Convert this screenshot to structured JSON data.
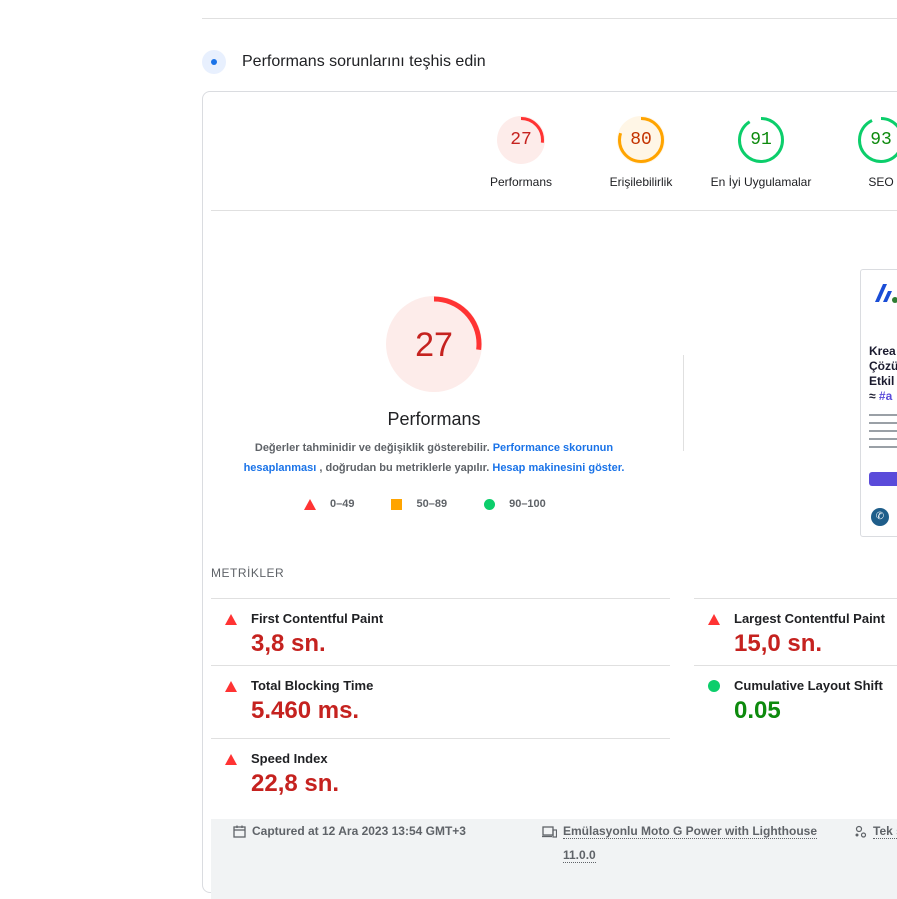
{
  "section": {
    "title": "Performans sorunlarını teşhis edin"
  },
  "gauges": [
    {
      "score": "27",
      "label": "Performans",
      "fraction": 0.27,
      "color": "#ff3333",
      "text_color": "#c5221f",
      "bg": "#fdecea"
    },
    {
      "score": "80",
      "label": "Erişilebilirlik",
      "fraction": 0.8,
      "color": "#ffa400",
      "text_color": "#c33300",
      "bg": "#fff6e6"
    },
    {
      "score": "91",
      "label": "En İyi Uygulamalar",
      "fraction": 0.91,
      "color": "#0cce6b",
      "text_color": "#0d8a0d",
      "bg": "#ffffff"
    },
    {
      "score": "93",
      "label": "SEO",
      "fraction": 0.93,
      "color": "#0cce6b",
      "text_color": "#0d8a0d",
      "bg": "#ffffff"
    }
  ],
  "main_score": {
    "score": "27",
    "label": "Performans",
    "fraction": 0.27
  },
  "description": {
    "part1": "Değerler tahminidir ve değişiklik gösterebilir. ",
    "link1": "Performance skorunun hesaplanması",
    "part2": " , doğrudan bu metriklerle yapılır. ",
    "link2": "Hesap makinesini göster."
  },
  "legend": [
    {
      "shape": "triangle",
      "range": "0–49"
    },
    {
      "shape": "square",
      "range": "50–89"
    },
    {
      "shape": "circle",
      "range": "90–100"
    }
  ],
  "preview": {
    "line1": "Krea",
    "line2": "Çözü",
    "line3": "Etkil",
    "line4_prefix": "≈ ",
    "line4_hash": "#a",
    "whatsapp_icon": "whatsapp-icon"
  },
  "metrics_title": "METRİKLER",
  "metrics": {
    "fcp": {
      "name": "First Contentful Paint",
      "value": "3,8 sn.",
      "status": "fail"
    },
    "lcp": {
      "name": "Largest Contentful Paint",
      "value": "15,0 sn.",
      "status": "fail"
    },
    "tbt": {
      "name": "Total Blocking Time",
      "value": "5.460 ms.",
      "status": "fail"
    },
    "cls": {
      "name": "Cumulative Layout Shift",
      "value": "0.05",
      "status": "pass"
    },
    "si": {
      "name": "Speed Index",
      "value": "22,8 sn.",
      "status": "fail"
    }
  },
  "footer": {
    "captured": "Captured at 12 Ara 2023 13:54 GMT+3",
    "emulation_line1": "Emülasyonlu Moto G Power with Lighthouse",
    "emulation_line2": "11.0.0",
    "session": "Tek s"
  },
  "colors": {
    "fail": "#ff3333",
    "average": "#ffa400",
    "pass": "#0cce6b",
    "link": "#1a73e8"
  }
}
